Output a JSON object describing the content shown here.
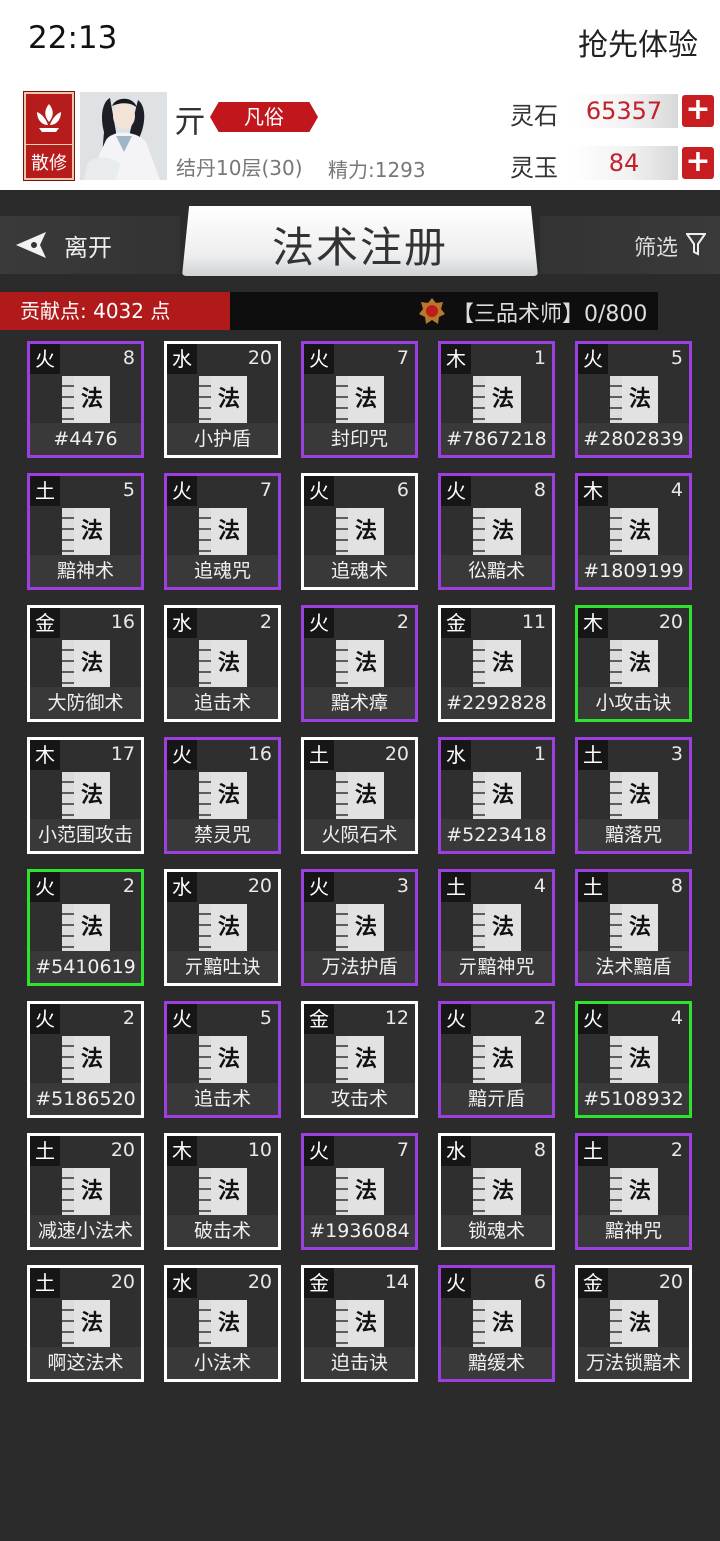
{
  "status": {
    "time": "22:13",
    "early_access": "抢先体验"
  },
  "profile": {
    "sect": "散修",
    "name": "亓",
    "realm": "凡俗",
    "cultivation": "结丹10层(30)",
    "energy": "精力:1293",
    "spirit_stone": {
      "label": "灵石",
      "value": "65357"
    },
    "spirit_jade": {
      "label": "灵玉",
      "value": "84"
    }
  },
  "header": {
    "back": "离开",
    "title": "法术注册",
    "filter": "筛选"
  },
  "contribution": "贡献点: 4032 点",
  "rank": "【三品术师】0/800",
  "book_glyph": "法",
  "colors": {
    "purple": "#9c3fdf",
    "white": "#ffffff",
    "green": "#2ee22e",
    "accent_red": "#c0161c"
  },
  "spells": [
    {
      "element": "火",
      "level": "8",
      "name": "#4476",
      "border": "purple"
    },
    {
      "element": "水",
      "level": "20",
      "name": "小护盾",
      "border": "white"
    },
    {
      "element": "火",
      "level": "7",
      "name": "封印咒",
      "border": "purple"
    },
    {
      "element": "木",
      "level": "1",
      "name": "#7867218",
      "border": "purple"
    },
    {
      "element": "火",
      "level": "5",
      "name": "#2802839",
      "border": "purple"
    },
    {
      "element": "土",
      "level": "5",
      "name": "黯神术",
      "border": "purple"
    },
    {
      "element": "火",
      "level": "7",
      "name": "追魂咒",
      "border": "purple"
    },
    {
      "element": "火",
      "level": "6",
      "name": "追魂术",
      "border": "white"
    },
    {
      "element": "火",
      "level": "8",
      "name": "彸黯术",
      "border": "purple"
    },
    {
      "element": "木",
      "level": "4",
      "name": "#1809199",
      "border": "purple"
    },
    {
      "element": "金",
      "level": "16",
      "name": "大防御术",
      "border": "white"
    },
    {
      "element": "水",
      "level": "2",
      "name": "追击术",
      "border": "white"
    },
    {
      "element": "火",
      "level": "2",
      "name": "黯术瘴",
      "border": "purple"
    },
    {
      "element": "金",
      "level": "11",
      "name": "#2292828",
      "border": "white"
    },
    {
      "element": "木",
      "level": "20",
      "name": "小攻击诀",
      "border": "green"
    },
    {
      "element": "木",
      "level": "17",
      "name": "小范围攻击",
      "border": "white"
    },
    {
      "element": "火",
      "level": "16",
      "name": "禁灵咒",
      "border": "purple"
    },
    {
      "element": "土",
      "level": "20",
      "name": "火陨石术",
      "border": "white"
    },
    {
      "element": "水",
      "level": "1",
      "name": "#5223418",
      "border": "purple"
    },
    {
      "element": "土",
      "level": "3",
      "name": "黯落咒",
      "border": "purple"
    },
    {
      "element": "火",
      "level": "2",
      "name": "#5410619",
      "border": "green"
    },
    {
      "element": "水",
      "level": "20",
      "name": "亓黯吐诀",
      "border": "white"
    },
    {
      "element": "火",
      "level": "3",
      "name": "万法护盾",
      "border": "purple"
    },
    {
      "element": "土",
      "level": "4",
      "name": "亓黯神咒",
      "border": "purple"
    },
    {
      "element": "土",
      "level": "8",
      "name": "法术黯盾",
      "border": "purple"
    },
    {
      "element": "火",
      "level": "2",
      "name": "#5186520",
      "border": "white"
    },
    {
      "element": "火",
      "level": "5",
      "name": "追击术",
      "border": "purple"
    },
    {
      "element": "金",
      "level": "12",
      "name": "攻击术",
      "border": "white"
    },
    {
      "element": "火",
      "level": "2",
      "name": "黯亓盾",
      "border": "purple"
    },
    {
      "element": "火",
      "level": "4",
      "name": "#5108932",
      "border": "green"
    },
    {
      "element": "土",
      "level": "20",
      "name": "减速小法术",
      "border": "white"
    },
    {
      "element": "木",
      "level": "10",
      "name": "破击术",
      "border": "white"
    },
    {
      "element": "火",
      "level": "7",
      "name": "#1936084",
      "border": "purple"
    },
    {
      "element": "水",
      "level": "8",
      "name": "锁魂术",
      "border": "white"
    },
    {
      "element": "土",
      "level": "2",
      "name": "黯神咒",
      "border": "purple"
    },
    {
      "element": "土",
      "level": "20",
      "name": "啊这法术",
      "border": "white"
    },
    {
      "element": "水",
      "level": "20",
      "name": "小法术",
      "border": "white"
    },
    {
      "element": "金",
      "level": "14",
      "name": "迫击诀",
      "border": "white"
    },
    {
      "element": "火",
      "level": "6",
      "name": "黯缓术",
      "border": "purple"
    },
    {
      "element": "金",
      "level": "20",
      "name": "万法锁黯术",
      "border": "white"
    }
  ]
}
